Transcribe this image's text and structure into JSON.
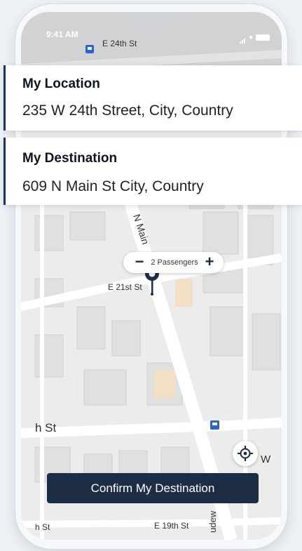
{
  "status_bar": {
    "time": "9:41 AM"
  },
  "route": {
    "origin": {
      "title": "My Location",
      "address": "235 W 24th Street, City, Country"
    },
    "destination": {
      "title": "My Destination",
      "address": "609 N Main St City, Country"
    }
  },
  "passengers": {
    "label": "2 Passengers",
    "decrement_icon": "minus-icon",
    "increment_icon": "plus-icon"
  },
  "map": {
    "street_labels": [
      "E 24th St",
      "N Main",
      "E 21st St",
      "h St",
      "W",
      "E 19th St",
      "h St",
      "udew"
    ],
    "destination_pin_icon": "map-pin-icon",
    "transit_icon": "bus-stop-icon",
    "locate_icon": "crosshair-icon"
  },
  "actions": {
    "confirm_label": "Confirm My Destination"
  },
  "theme": {
    "accent": "#1c2d45",
    "map_bg": "#ececec",
    "card_bg": "#ffffff"
  }
}
